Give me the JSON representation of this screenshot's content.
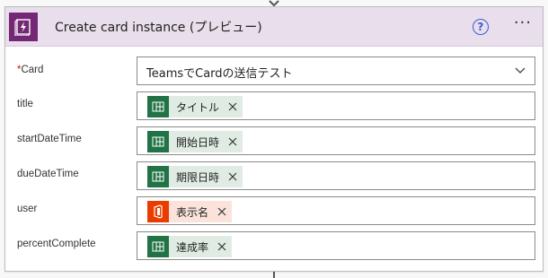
{
  "action": {
    "title": "Create card instance (プレビュー)",
    "help_glyph": "?",
    "more_glyph": "···",
    "accent_color": "#742774"
  },
  "fields": {
    "card": {
      "label": "Card",
      "required_mark": "*",
      "selected_value": "TeamsでCardの送信テスト"
    },
    "title": {
      "label": "title",
      "token": "タイトル",
      "token_source": "excel"
    },
    "startDateTime": {
      "label": "startDateTime",
      "token": "開始日時",
      "token_source": "excel"
    },
    "dueDateTime": {
      "label": "dueDateTime",
      "token": "期限日時",
      "token_source": "excel"
    },
    "user": {
      "label": "user",
      "token": "表示名",
      "token_source": "office365"
    },
    "percentComplete": {
      "label": "percentComplete",
      "token": "達成率",
      "token_source": "excel"
    }
  },
  "icons": {
    "app": "bolt-book-icon",
    "excel_token": "excel-table-icon",
    "office_token": "office-icon",
    "remove": "close-icon",
    "dropdown": "chevron-down-icon"
  },
  "colors": {
    "header_bg": "#e9deeb",
    "excel_green": "#217346",
    "office_orange": "#eb3c00"
  }
}
